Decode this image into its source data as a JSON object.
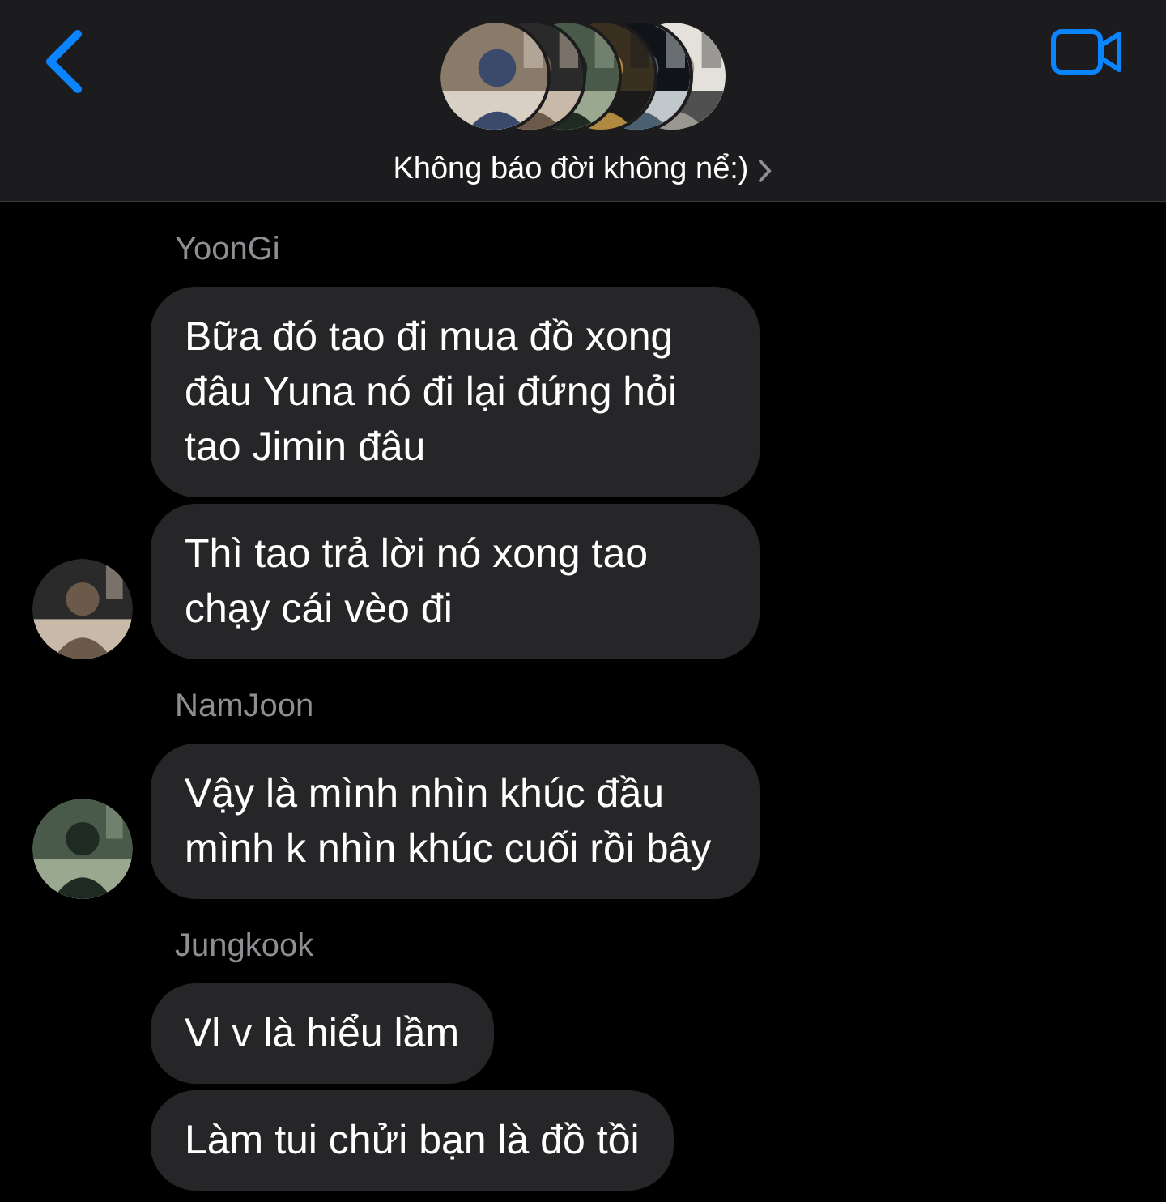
{
  "header": {
    "title": "Không báo đời không nể:)"
  },
  "groups": [
    {
      "sender": "YoonGi",
      "avatar": true,
      "bubbles": [
        "Bữa đó tao đi mua đồ xong đâu Yuna nó đi lại đứng hỏi tao Jimin đâu",
        "Thì tao trả lời nó xong tao chạy cái vèo đi"
      ]
    },
    {
      "sender": "NamJoon",
      "avatar": true,
      "bubbles": [
        "Vậy là mình nhìn khúc đầu mình k nhìn khúc cuối rồi bây"
      ]
    },
    {
      "sender": "Jungkook",
      "avatar": false,
      "bubbles": [
        "Vl v là hiểu lầm",
        "Làm tui chửi bạn là đồ tồi"
      ]
    }
  ]
}
